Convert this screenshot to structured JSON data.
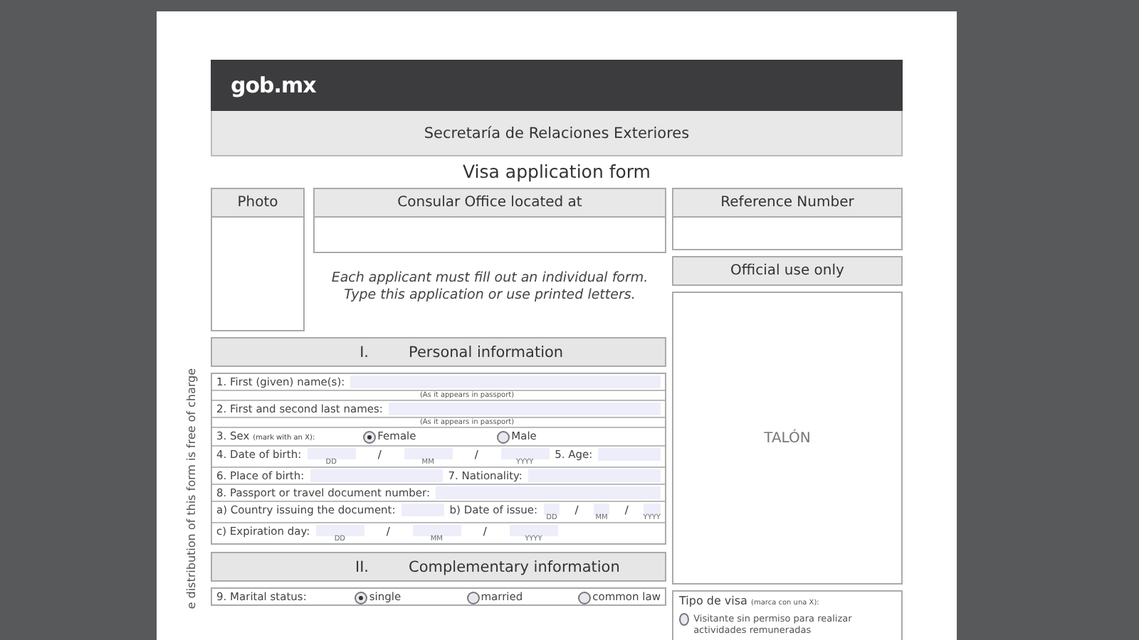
{
  "header": {
    "logo": "gob.mx",
    "agency": "Secretaría de Relaciones Exteriores",
    "title": "Visa application form"
  },
  "photo": {
    "label": "Photo"
  },
  "consular_office": {
    "label": "Consular Office located at"
  },
  "instructions": [
    "Each applicant must fill out an individual form.",
    "Type this application or use printed letters."
  ],
  "side_note": "e distribution of this form is free of charge",
  "sections": [
    {
      "number": "I.",
      "title": "Personal information",
      "rows": [
        {
          "kind": "line",
          "parts": [
            {
              "kind": "label",
              "text": "1. First (given) name(s):"
            },
            {
              "kind": "field"
            }
          ]
        },
        {
          "kind": "note",
          "text": "(As it appears in passport)"
        },
        {
          "kind": "line",
          "parts": [
            {
              "kind": "label",
              "text": "2. First and second last names:"
            },
            {
              "kind": "field"
            }
          ]
        },
        {
          "kind": "note",
          "text": "(As it appears in passport)"
        },
        {
          "kind": "line",
          "parts": [
            {
              "kind": "label",
              "text": "3. Sex",
              "small": "(mark with an X):"
            },
            {
              "kind": "radio",
              "label": "Female",
              "selected": true
            },
            {
              "kind": "radio",
              "label": "Male",
              "selected": false
            }
          ]
        },
        {
          "kind": "line",
          "parts": [
            {
              "kind": "label",
              "text": "4. Date of birth:"
            },
            {
              "kind": "date",
              "hint": "DD"
            },
            {
              "kind": "slash",
              "text": "/"
            },
            {
              "kind": "date",
              "hint": "MM"
            },
            {
              "kind": "slash",
              "text": "/"
            },
            {
              "kind": "date",
              "hint": "YYYY"
            },
            {
              "kind": "label",
              "text": "5. Age:"
            },
            {
              "kind": "field"
            }
          ]
        },
        {
          "kind": "line",
          "parts": [
            {
              "kind": "label",
              "text": "6. Place of birth:"
            },
            {
              "kind": "field"
            },
            {
              "kind": "label",
              "text": "7. Nationality:"
            },
            {
              "kind": "field"
            }
          ]
        },
        {
          "kind": "line",
          "parts": [
            {
              "kind": "label",
              "text": "8. Passport or travel document number:"
            },
            {
              "kind": "field"
            }
          ]
        },
        {
          "kind": "line",
          "parts": [
            {
              "kind": "label",
              "text": "a) Country issuing the document:"
            },
            {
              "kind": "field"
            },
            {
              "kind": "label",
              "text": "b) Date of issue:"
            },
            {
              "kind": "mini",
              "hint": "DD"
            },
            {
              "kind": "slash",
              "text": "/"
            },
            {
              "kind": "mini",
              "hint": "MM"
            },
            {
              "kind": "slash",
              "text": "/"
            },
            {
              "kind": "mini",
              "hint": "YYYY"
            }
          ]
        },
        {
          "kind": "line",
          "parts": [
            {
              "kind": "label",
              "text": "c) Expiration day:"
            },
            {
              "kind": "date",
              "hint": "DD"
            },
            {
              "kind": "slash",
              "text": "/"
            },
            {
              "kind": "date",
              "hint": "MM"
            },
            {
              "kind": "slash",
              "text": "/"
            },
            {
              "kind": "date",
              "hint": "YYYY"
            }
          ]
        }
      ]
    },
    {
      "number": "II.",
      "title": "Complementary information",
      "rows": [
        {
          "kind": "line",
          "parts": [
            {
              "kind": "label",
              "text": "9. Marital status:"
            },
            {
              "kind": "radio",
              "label": "single",
              "selected": true
            },
            {
              "kind": "radio",
              "label": "married",
              "selected": false
            },
            {
              "kind": "radio",
              "label": "common law",
              "selected": false
            }
          ]
        }
      ]
    }
  ],
  "reference_number": {
    "label": "Reference Number"
  },
  "official_use": {
    "label": "Official use only",
    "stamp": "TALÓN"
  },
  "visa_type": {
    "label": "Tipo de visa",
    "note": "(marca con una X):",
    "options": [
      {
        "label": "Visitante sin permiso para realizar actividades remuneradas",
        "selected": false
      }
    ]
  }
}
